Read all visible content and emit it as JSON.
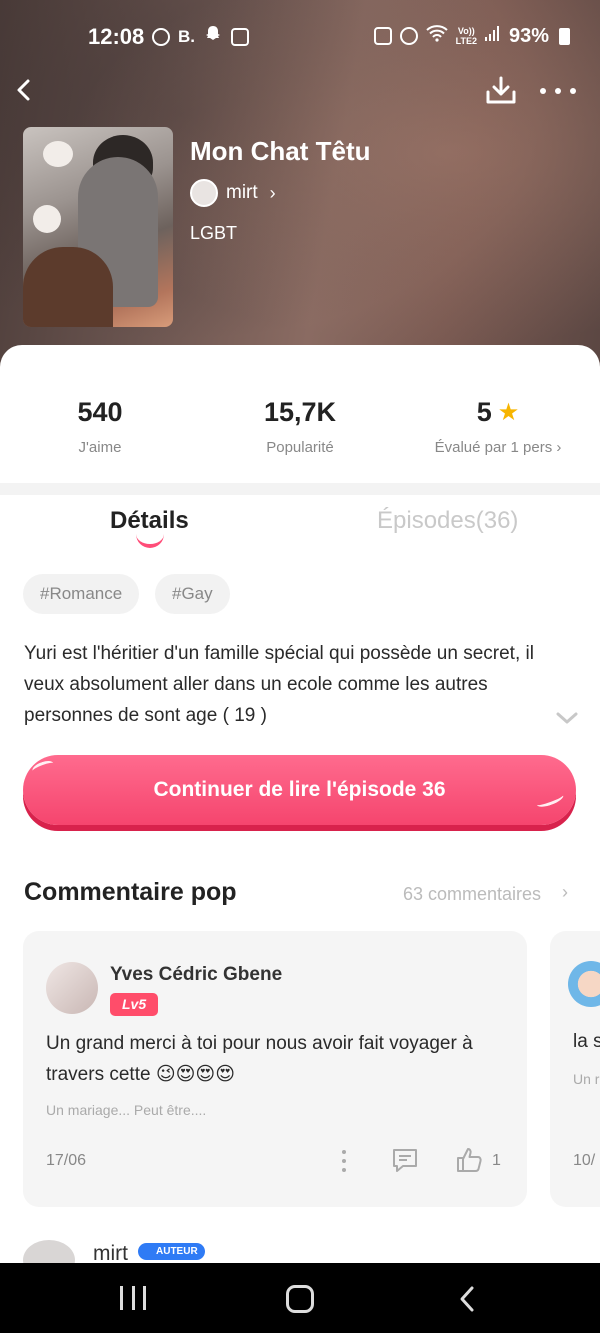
{
  "status_bar": {
    "time": "12:08",
    "left_icons": [
      "data-saver-icon",
      "b-icon",
      "snapchat-icon",
      "gallery-icon"
    ],
    "b_label": "B.",
    "right_icons": [
      "lock-icon",
      "alarm-icon",
      "wifi-icon",
      "signal-icon",
      "battery-icon"
    ],
    "lte_top": "Vo))",
    "lte_bottom": "LTE2",
    "battery": "93%"
  },
  "header": {
    "title": "Mon Chat Têtu",
    "author": "mirt",
    "genre": "LGBT"
  },
  "stats": [
    {
      "value": "540",
      "label": "J'aime"
    },
    {
      "value": "15,7K",
      "label": "Popularité"
    },
    {
      "value": "5",
      "label": "Évalué par 1 pers"
    }
  ],
  "tabs": {
    "details": "Détails",
    "episodes": "Épisodes(36)"
  },
  "tags": [
    "#Romance",
    "#Gay"
  ],
  "synopsis": "Yuri est l'héritier d'un famille spécial qui possède un secret, il veux absolument aller dans un ecole comme les autres personnes de sont age (  19 )",
  "cta_label": "Continuer de lire l'épisode 36",
  "comments": {
    "title": "Commentaire pop",
    "count_label": "63 commentaires",
    "items": [
      {
        "name": "Yves Cédric Gbene",
        "level": "Lv5",
        "text": "Un grand merci à toi pour nous avoir fait voyager à travers cette 😉😍😍😍",
        "subtext": "Un mariage... Peut être....",
        "date": "17/06",
        "likes": "1"
      },
      {
        "text": "la s",
        "subtext": "Un r",
        "date": "10/"
      }
    ]
  },
  "next_comment": {
    "name": "mirt",
    "badge": "AUTEUR"
  },
  "colors": {
    "accent": "#f5456e",
    "star": "#f7b500",
    "level_badge": "#ff4d6a",
    "author_badge": "#2f7bf5"
  }
}
